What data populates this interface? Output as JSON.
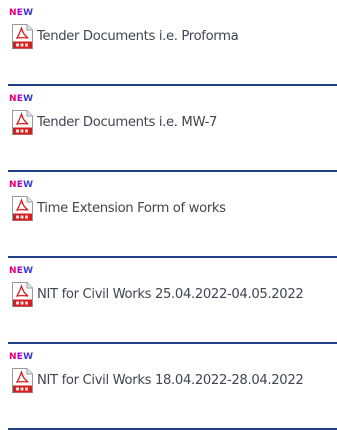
{
  "documents": [
    {
      "badge": "NEW",
      "title": "Tender Documents i.e. Proforma",
      "icon": "pdf-icon"
    },
    {
      "badge": "NEW",
      "title": "Tender Documents i.e. MW-7",
      "icon": "pdf-icon"
    },
    {
      "badge": "NEW",
      "title": "Time Extension Form of works",
      "icon": "pdf-icon"
    },
    {
      "badge": "NEW",
      "title": "NIT for Civil Works 25.04.2022-04.05.2022",
      "icon": "pdf-icon"
    },
    {
      "badge": "NEW",
      "title": "NIT for Civil Works 18.04.2022-28.04.2022",
      "icon": "pdf-icon"
    }
  ],
  "colors": {
    "divider": "#1f3f86",
    "badge_gradient": [
      "#e3006e",
      "#b300c8",
      "#3b3bdc"
    ],
    "pdf_red": "#d71e1e",
    "text": "#3f4750"
  }
}
